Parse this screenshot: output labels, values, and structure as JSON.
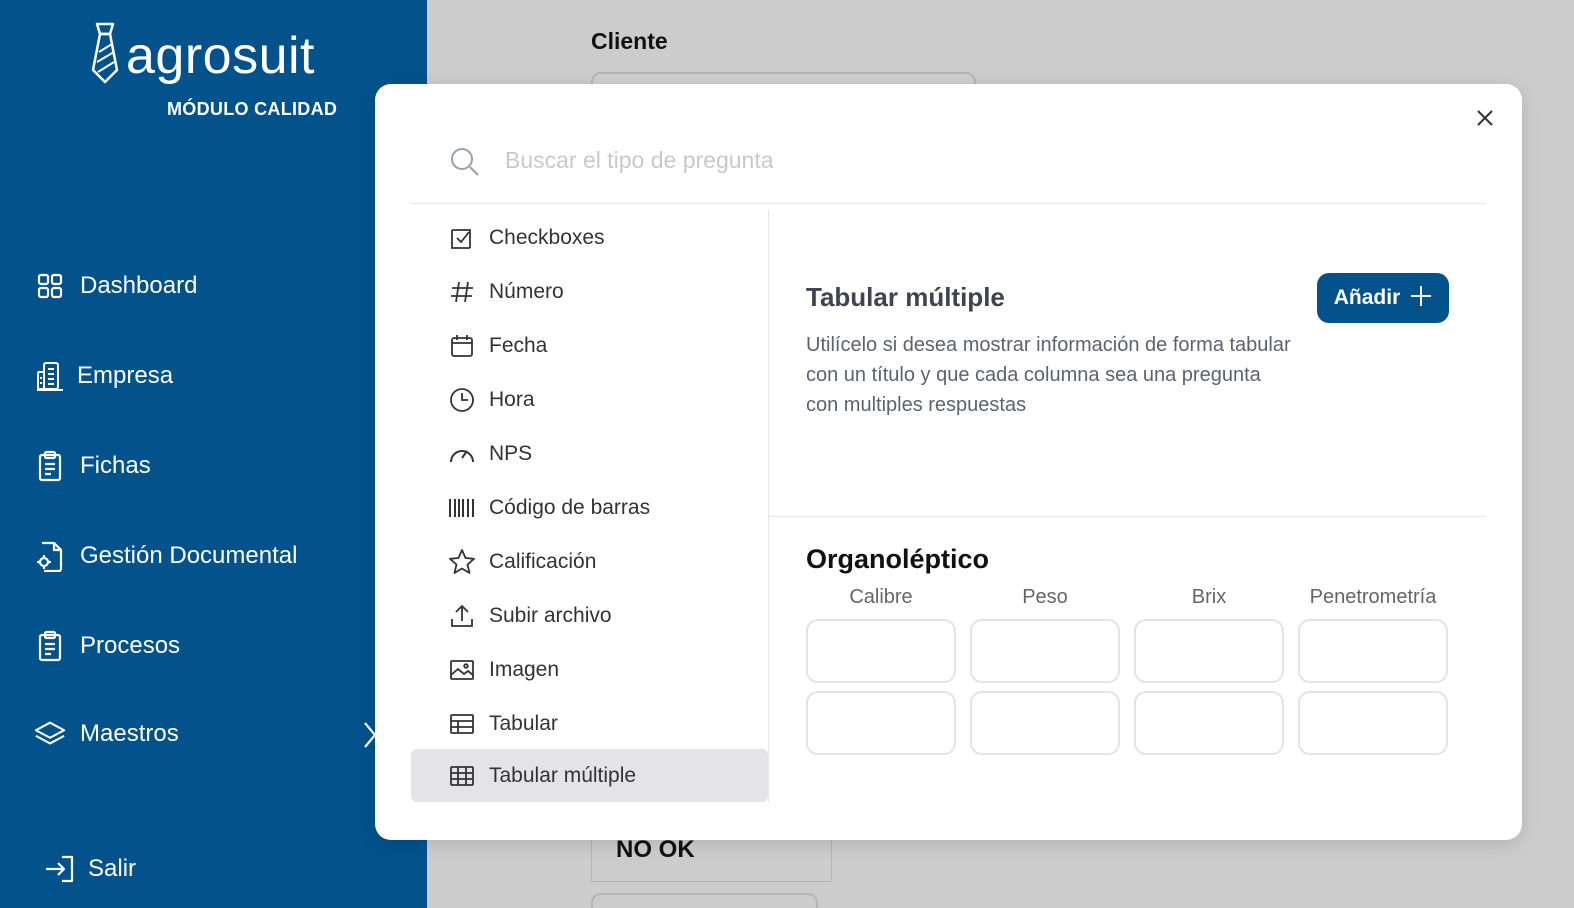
{
  "app": {
    "logo_text": "agrosuit",
    "module_label": "MÓDULO CALIDAD"
  },
  "sidebar": {
    "items": [
      {
        "label": "Dashboard",
        "icon": "grid-icon"
      },
      {
        "label": "Empresa",
        "icon": "building-icon"
      },
      {
        "label": "Fichas",
        "icon": "clipboard-icon"
      },
      {
        "label": "Gestión Documental",
        "icon": "document-gear-icon"
      },
      {
        "label": "Procesos",
        "icon": "clipboard-icon"
      },
      {
        "label": "Maestros",
        "icon": "layers-icon"
      }
    ],
    "logout_label": "Salir"
  },
  "background": {
    "field_label": "Cliente",
    "cell_value": "NO OK"
  },
  "modal": {
    "search_placeholder": "Buscar el tipo de pregunta",
    "question_types": [
      {
        "label": "Checkboxes",
        "icon": "checkbox-icon"
      },
      {
        "label": "Número",
        "icon": "hash-icon"
      },
      {
        "label": "Fecha",
        "icon": "calendar-icon"
      },
      {
        "label": "Hora",
        "icon": "clock-icon"
      },
      {
        "label": "NPS",
        "icon": "gauge-icon"
      },
      {
        "label": "Código de barras",
        "icon": "barcode-icon"
      },
      {
        "label": "Calificación",
        "icon": "star-icon"
      },
      {
        "label": "Subir archivo",
        "icon": "upload-icon"
      },
      {
        "label": "Imagen",
        "icon": "image-icon"
      },
      {
        "label": "Tabular",
        "icon": "table-icon"
      },
      {
        "label": "Tabular múltiple",
        "icon": "table-grid-icon"
      }
    ],
    "selected_type": "Tabular múltiple",
    "detail": {
      "title": "Tabular múltiple",
      "description": "Utilícelo si desea mostrar información de forma tabular con un título y que cada columna sea una pregunta con multiples respuestas",
      "add_label": "Añadir"
    },
    "preview": {
      "title": "Organoléptico",
      "columns": [
        "Calibre",
        "Peso",
        "Brix",
        "Penetrometría"
      ],
      "rows": 2
    }
  },
  "colors": {
    "brand": "#03528c",
    "overlay": "#cccccc",
    "selected_item": "#e4e4e7"
  }
}
